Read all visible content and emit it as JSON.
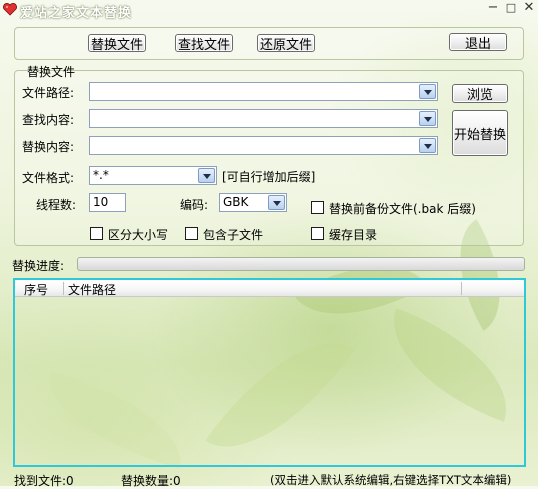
{
  "window": {
    "title": "爱站之家文本替换",
    "minimize": "−",
    "maximize": "□",
    "close": "✕"
  },
  "toolbar": {
    "replace_file": "替换文件",
    "find_file": "查找文件",
    "restore_file": "还原文件",
    "exit": "退出"
  },
  "group": {
    "title": "替换文件"
  },
  "form": {
    "file_path_label": "文件路径:",
    "file_path_value": "",
    "find_label": "查找内容:",
    "find_value": "",
    "replace_label": "替换内容:",
    "replace_value": "",
    "browse": "浏览",
    "start": "开始替换",
    "format_label": "文件格式:",
    "format_value": "*.*",
    "format_hint": "[可自行增加后缀]",
    "threads_label": "线程数:",
    "threads_value": "10",
    "encoding_label": "编码:",
    "encoding_value": "GBK",
    "backup_label": "替换前备份文件(.bak 后缀)",
    "backup_checked": false,
    "case_label": "区分大小写",
    "case_checked": false,
    "subdir_label": "包含子文件",
    "subdir_checked": false,
    "cache_label": "缓存目录",
    "cache_checked": false
  },
  "progress": {
    "label": "替换进度:",
    "value": 0
  },
  "list": {
    "columns": [
      "序号",
      "文件路径"
    ],
    "rows": []
  },
  "status": {
    "found": "找到文件:0",
    "replaced": "替换数量:0",
    "hint": "(双击进入默认系统编辑,右键选择TXT文本编辑)"
  }
}
